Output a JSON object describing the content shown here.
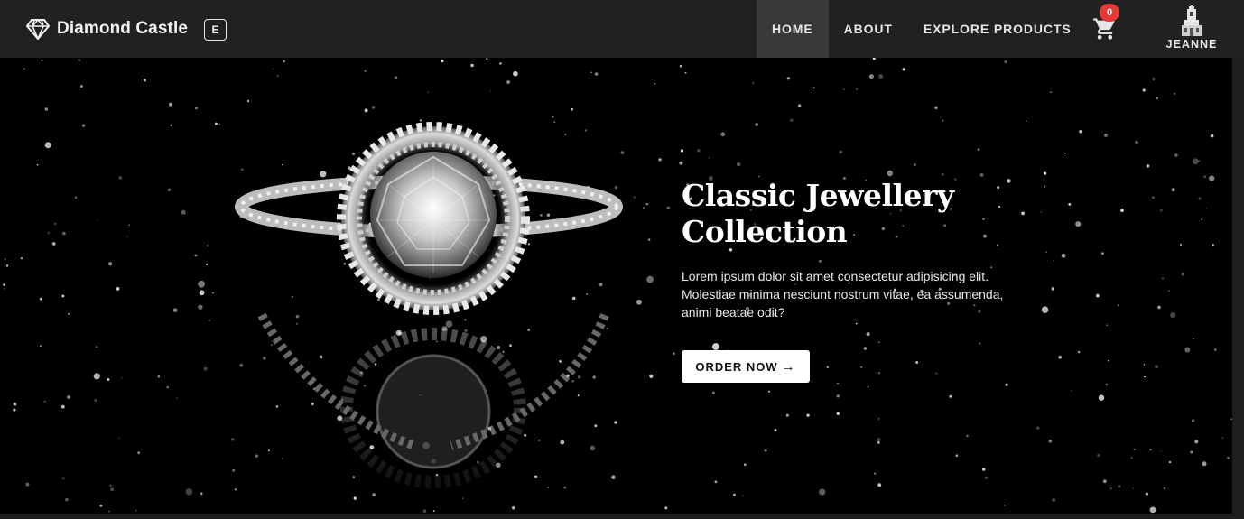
{
  "header": {
    "brand_name": "Diamond Castle",
    "brand_icon": "diamond-icon",
    "e_badge": "E",
    "nav": [
      {
        "label": "HOME",
        "active": true
      },
      {
        "label": "ABOUT",
        "active": false
      },
      {
        "label": "EXPLORE PRODUCTS",
        "active": false
      }
    ],
    "cart_icon": "cart-icon",
    "cart_count": "0",
    "user_name": "JEANNE"
  },
  "hero": {
    "title": "Classic Jewellery Collection",
    "description": "Lorem ipsum dolor sit amet consectetur adipisicing elit. Molestiae minima nesciunt nostrum vitae, ea assumenda, animi beatae odit?",
    "button_label": "ORDER NOW",
    "button_icon": "arrow-right-icon"
  },
  "colors": {
    "navbar": "#212121",
    "active_nav": "#393939",
    "hero_bg": "#000000",
    "badge": "#e53935",
    "button_bg": "#ffffff"
  }
}
